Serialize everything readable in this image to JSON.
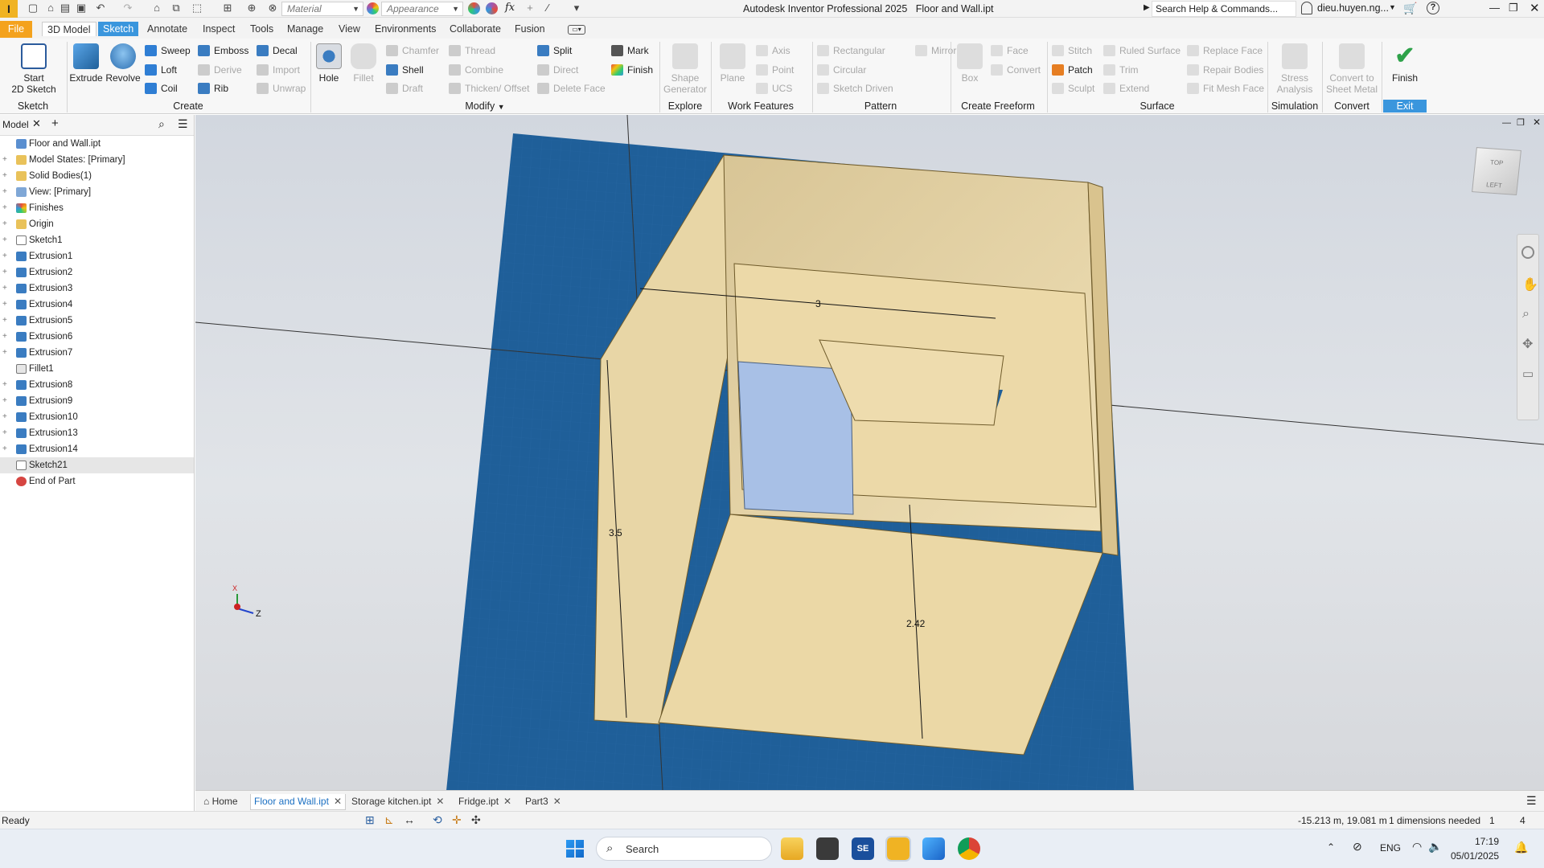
{
  "app": {
    "title": "Autodesk Inventor Professional 2025",
    "document": "Floor and Wall.ipt",
    "logo_letter": "I"
  },
  "qat": {
    "material_placeholder": "Material",
    "appearance_placeholder": "Appearance",
    "fx": "fx"
  },
  "search": {
    "placeholder": "Search Help & Commands..."
  },
  "user": {
    "name": "dieu.huyen.ng..."
  },
  "tabs": [
    "File",
    "3D Model",
    "Sketch",
    "Annotate",
    "Inspect",
    "Tools",
    "Manage",
    "View",
    "Environments",
    "Collaborate",
    "Fusion"
  ],
  "ribbon": {
    "sketch": {
      "label": "Sketch",
      "start2d": "Start",
      "start2d_line2": "2D Sketch"
    },
    "create": {
      "label": "Create",
      "extrude": "Extrude",
      "revolve": "Revolve",
      "sweep": "Sweep",
      "loft": "Loft",
      "coil": "Coil",
      "emboss": "Emboss",
      "derive": "Derive",
      "rib": "Rib",
      "decal": "Decal",
      "import": "Import",
      "unwrap": "Unwrap"
    },
    "modify": {
      "label": "Modify",
      "hole": "Hole",
      "fillet": "Fillet",
      "chamfer": "Chamfer",
      "shell": "Shell",
      "draft": "Draft",
      "thread": "Thread",
      "combine": "Combine",
      "thicken": "Thicken/ Offset",
      "split": "Split",
      "direct": "Direct",
      "delete_face": "Delete Face",
      "mark": "Mark",
      "finish": "Finish"
    },
    "explore": {
      "label": "Explore",
      "shape_gen": "Shape",
      "shape_gen_line2": "Generator"
    },
    "work": {
      "label": "Work Features",
      "plane": "Plane",
      "axis": "Axis",
      "point": "Point",
      "ucs": "UCS"
    },
    "pattern": {
      "label": "Pattern",
      "rectangular": "Rectangular",
      "circular": "Circular",
      "sketch_driven": "Sketch Driven",
      "mirror": "Mirror"
    },
    "freeform": {
      "label": "Create Freeform",
      "box": "Box",
      "face": "Face",
      "convert": "Convert"
    },
    "surface": {
      "label": "Surface",
      "stitch": "Stitch",
      "patch": "Patch",
      "sculpt": "Sculpt",
      "ruled": "Ruled Surface",
      "trim": "Trim",
      "extend": "Extend",
      "replace": "Replace Face",
      "repair": "Repair Bodies",
      "fitmesh": "Fit Mesh Face"
    },
    "simulation": {
      "label": "Simulation",
      "stress": "Stress",
      "stress_line2": "Analysis"
    },
    "convert": {
      "label": "Convert",
      "sheet": "Convert to",
      "sheet_line2": "Sheet Metal"
    },
    "exit": {
      "label": "Exit",
      "finish": "Finish"
    }
  },
  "browser": {
    "tab": "Model",
    "items": [
      {
        "label": "Floor and Wall.ipt",
        "icon": "part-icon",
        "exp": ""
      },
      {
        "label": "Model States: [Primary]",
        "icon": "folder-icon",
        "exp": "+"
      },
      {
        "label": "Solid Bodies(1)",
        "icon": "folder-icon",
        "exp": "+"
      },
      {
        "label": "View: [Primary]",
        "icon": "view-icon",
        "exp": "+"
      },
      {
        "label": "Finishes",
        "icon": "finish-icon",
        "exp": "+"
      },
      {
        "label": "Origin",
        "icon": "folder-icon",
        "exp": "+"
      },
      {
        "label": "Sketch1",
        "icon": "sketch-icon",
        "exp": "+"
      },
      {
        "label": "Extrusion1",
        "icon": "extrusion-icon",
        "exp": "+"
      },
      {
        "label": "Extrusion2",
        "icon": "extrusion-icon",
        "exp": "+"
      },
      {
        "label": "Extrusion3",
        "icon": "extrusion-icon",
        "exp": "+"
      },
      {
        "label": "Extrusion4",
        "icon": "extrusion-icon",
        "exp": "+"
      },
      {
        "label": "Extrusion5",
        "icon": "extrusion-icon",
        "exp": "+"
      },
      {
        "label": "Extrusion6",
        "icon": "extrusion-icon",
        "exp": "+"
      },
      {
        "label": "Extrusion7",
        "icon": "extrusion-icon",
        "exp": "+"
      },
      {
        "label": "Fillet1",
        "icon": "fillet-icon",
        "exp": ""
      },
      {
        "label": "Extrusion8",
        "icon": "extrusion-icon",
        "exp": "+"
      },
      {
        "label": "Extrusion9",
        "icon": "extrusion-icon",
        "exp": "+"
      },
      {
        "label": "Extrusion10",
        "icon": "extrusion-icon",
        "exp": "+"
      },
      {
        "label": "Extrusion13",
        "icon": "extrusion-icon",
        "exp": "+"
      },
      {
        "label": "Extrusion14",
        "icon": "extrusion-icon",
        "exp": "+"
      },
      {
        "label": "Sketch21",
        "icon": "sketch-icon",
        "exp": ""
      },
      {
        "label": "End of Part",
        "icon": "end-icon",
        "exp": ""
      }
    ]
  },
  "viewport": {
    "dim_width": "3",
    "dim_height": "3.5",
    "dim_depth": "2.42",
    "viewcube_top": "TOP",
    "viewcube_left": "LEFT",
    "axis_x": "X",
    "axis_z": "Z"
  },
  "doctabs": {
    "home": "Home",
    "items": [
      "Floor and Wall.ipt",
      "Storage kitchen.ipt",
      "Fridge.ipt",
      "Part3"
    ]
  },
  "status": {
    "text": "Ready",
    "coords": "-15.213 m, 19.081 m",
    "dims": "1 dimensions needed",
    "n1": "1",
    "n2": "4"
  },
  "taskbar": {
    "search": "Search",
    "lang": "ENG",
    "time": "17:19",
    "date": "05/01/2025",
    "se": "SE"
  },
  "colors": {
    "accent": "#3a96dd",
    "file_tab": "#f4a21d",
    "model_face": "#ecd9a8",
    "floor": "#1f5f99"
  }
}
